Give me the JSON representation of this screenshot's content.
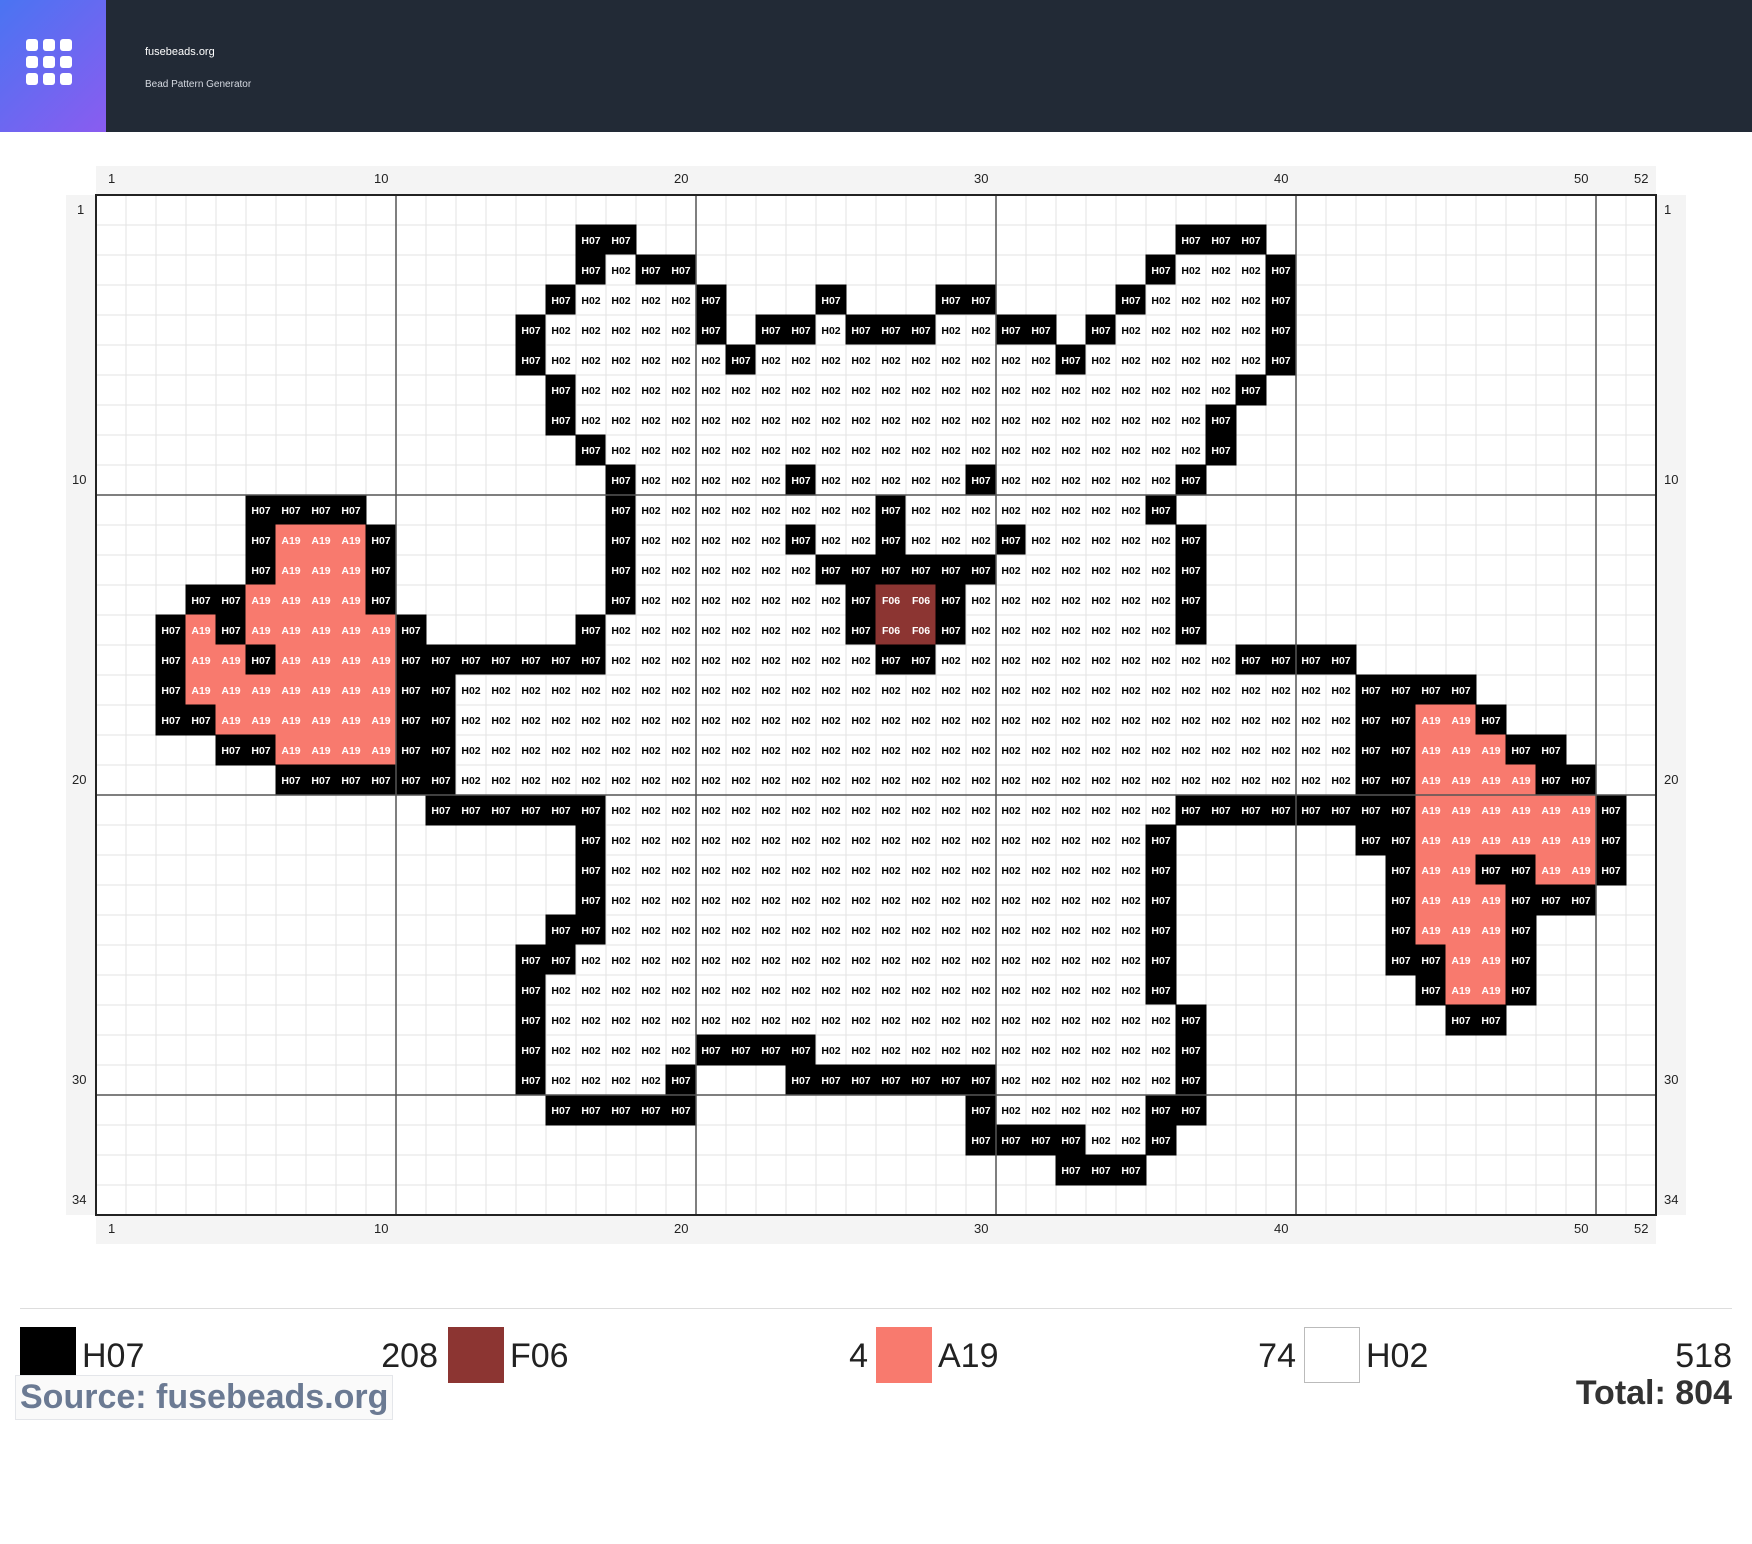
{
  "header": {
    "site_name": "fusebeads.org",
    "subtitle": "Bead Pattern Generator",
    "logo_icon": "grid-icon"
  },
  "pattern": {
    "cols": 52,
    "rows": 34,
    "col_ticks": [
      "1",
      "10",
      "20",
      "30",
      "40",
      "50",
      "52"
    ],
    "row_ticks": [
      "1",
      "10",
      "20",
      "30",
      "34"
    ],
    "palette": {
      "H07": {
        "fill": "#000000",
        "text": "#ffffff"
      },
      "H02": {
        "fill": "#ffffff",
        "text": "#000000"
      },
      "A19": {
        "fill": "#f87a6e",
        "text": "#ffffff"
      },
      "F06": {
        "fill": "#8c3532",
        "text": "#ffffff"
      }
    },
    "rows_data": [
      "",
      "",
      "",
      "",
      "",
      "",
      "",
      "",
      "",
      "",
      "",
      "",
      "",
      "",
      "",
      "",
      "",
      "",
      "",
      "",
      "",
      "",
      "",
      "",
      "",
      "",
      "",
      "",
      "",
      "",
      "",
      "",
      "",
      ""
    ]
  },
  "legend": {
    "items": [
      {
        "code": "H07",
        "count": "208",
        "color": "#000000"
      },
      {
        "code": "F06",
        "count": "4",
        "color": "#8c3532"
      },
      {
        "code": "A19",
        "count": "74",
        "color": "#f87a6e"
      },
      {
        "code": "H02",
        "count": "518",
        "color": "#ffffff"
      }
    ],
    "source": "Source: fusebeads.org",
    "total": "Total: 804"
  }
}
